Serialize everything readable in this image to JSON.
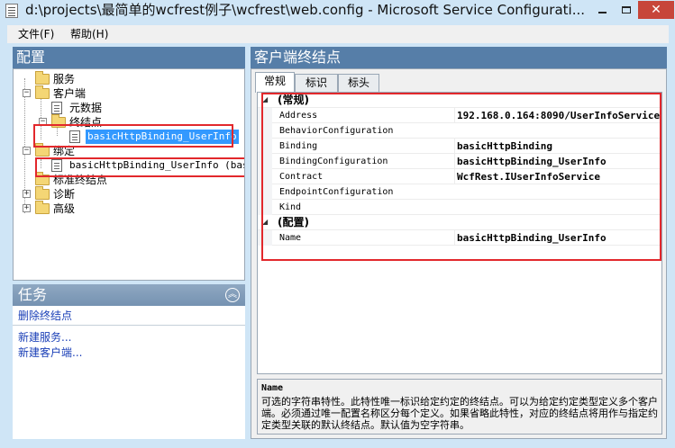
{
  "window": {
    "title": "d:\\projects\\最简单的wcfrest例子\\wcfrest\\web.config - Microsoft Service Configurati...",
    "close_label": "✕"
  },
  "menu": {
    "file": "文件(F)",
    "help": "帮助(H)"
  },
  "config_panel": {
    "title": "配置",
    "tree": {
      "services": "服务",
      "client": "客户端",
      "metadata": "元数据",
      "endpoints": "终结点",
      "endpoint_item": "basicHttpBinding_UserInfo",
      "bindings": "绑定",
      "binding_item": "basicHttpBinding_UserInfo (basic",
      "standard_endpoints": "标准终结点",
      "diagnostics": "诊断",
      "advanced": "高级"
    }
  },
  "tasks_panel": {
    "title": "任务",
    "delete_endpoint": "删除终结点",
    "new_service": "新建服务...",
    "new_client": "新建客户端..."
  },
  "endpoint_panel": {
    "title": "客户端终结点",
    "tabs": [
      "常规",
      "标识",
      "标头"
    ],
    "active_tab": 0,
    "category_general": "(常规)",
    "category_config": "(配置)",
    "properties_general": [
      {
        "name": "Address",
        "value": "192.168.0.164:8090/UserInfoService"
      },
      {
        "name": "BehaviorConfiguration",
        "value": ""
      },
      {
        "name": "Binding",
        "value": "basicHttpBinding"
      },
      {
        "name": "BindingConfiguration",
        "value": "basicHttpBinding_UserInfo"
      },
      {
        "name": "Contract",
        "value": "WcfRest.IUserInfoService"
      },
      {
        "name": "EndpointConfiguration",
        "value": ""
      },
      {
        "name": "Kind",
        "value": ""
      }
    ],
    "properties_config": [
      {
        "name": "Name",
        "value": "basicHttpBinding_UserInfo"
      }
    ],
    "description": {
      "title": "Name",
      "text": "可选的字符串特性。此特性唯一标识给定约定的终结点。可以为给定约定类型定义多个客户端。必须通过唯一配置名称区分每个定义。如果省略此特性，对应的终结点将用作与指定约定类型关联的默认终结点。默认值为空字符串。"
    }
  },
  "colors": {
    "panel_header": "#567ea8",
    "selection": "#3399ff",
    "highlight_box": "#e2282c",
    "link": "#1a3fb7",
    "close_button": "#c7463a"
  }
}
